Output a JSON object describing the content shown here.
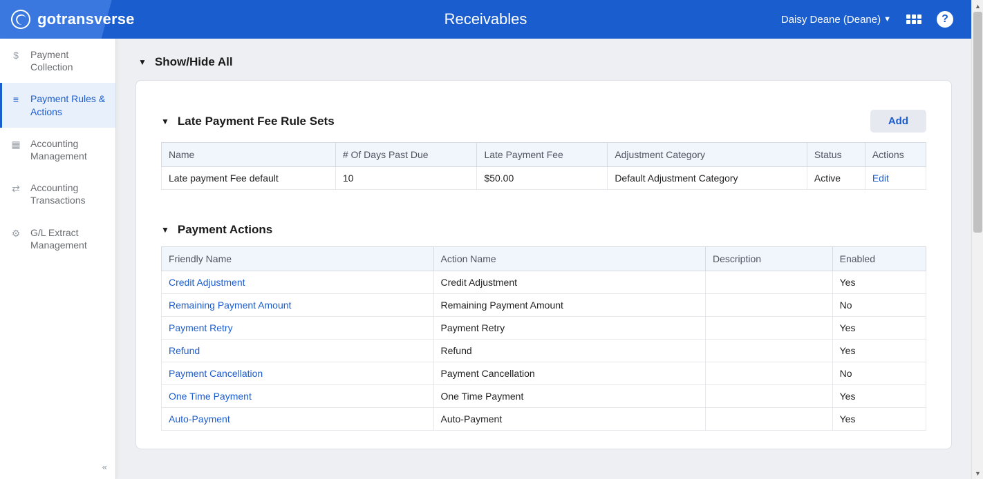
{
  "brand": "gotransverse",
  "page_title": "Receivables",
  "user_display": "Daisy Deane (Deane)",
  "sidebar": {
    "items": [
      {
        "label": "Payment Collection",
        "icon": "$"
      },
      {
        "label": "Payment Rules & Actions",
        "icon": "≡"
      },
      {
        "label": "Accounting Management",
        "icon": "▦"
      },
      {
        "label": "Accounting Transactions",
        "icon": "⇄"
      },
      {
        "label": "G/L Extract Management",
        "icon": "⚙"
      }
    ]
  },
  "toggle_all_label": "Show/Hide All",
  "sections": {
    "late_fee": {
      "title": "Late Payment Fee Rule Sets",
      "add_label": "Add",
      "columns": [
        "Name",
        "# Of Days Past Due",
        "Late Payment Fee",
        "Adjustment Category",
        "Status",
        "Actions"
      ],
      "rows": [
        {
          "name": "Late payment Fee default",
          "days": "10",
          "fee": "$50.00",
          "category": "Default Adjustment Category",
          "status": "Active",
          "action": "Edit"
        }
      ]
    },
    "payment_actions": {
      "title": "Payment Actions",
      "columns": [
        "Friendly Name",
        "Action Name",
        "Description",
        "Enabled"
      ],
      "rows": [
        {
          "friendly": "Credit Adjustment",
          "action": "Credit Adjustment",
          "desc": "",
          "enabled": "Yes"
        },
        {
          "friendly": "Remaining Payment Amount",
          "action": "Remaining Payment Amount",
          "desc": "",
          "enabled": "No"
        },
        {
          "friendly": "Payment Retry",
          "action": "Payment Retry",
          "desc": "",
          "enabled": "Yes"
        },
        {
          "friendly": "Refund",
          "action": "Refund",
          "desc": "",
          "enabled": "Yes"
        },
        {
          "friendly": "Payment Cancellation",
          "action": "Payment Cancellation",
          "desc": "",
          "enabled": "No"
        },
        {
          "friendly": "One Time Payment",
          "action": "One Time Payment",
          "desc": "",
          "enabled": "Yes"
        },
        {
          "friendly": "Auto-Payment",
          "action": "Auto-Payment",
          "desc": "",
          "enabled": "Yes"
        }
      ]
    }
  }
}
